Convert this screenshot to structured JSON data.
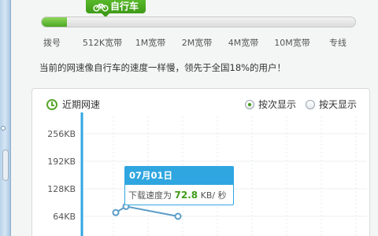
{
  "speed_badge": {
    "label": "自行车",
    "icon": "bicycle-icon"
  },
  "speed_bar": {
    "fill_fraction": 0.08
  },
  "speed_ticks": [
    "拨号",
    "512K宽带",
    "1M宽带",
    "2M宽带",
    "4M宽带",
    "10M宽带",
    "专线"
  ],
  "summary_text": "当前的网速像自行车的速度一样慢，领先于全国18%的用户！",
  "chart_panel": {
    "title": "近期网速",
    "title_icon": "clock-icon",
    "view_options": [
      {
        "label": "按次显示",
        "selected": true
      },
      {
        "label": "按天显示",
        "selected": false
      }
    ]
  },
  "tooltip": {
    "date": "07月01日",
    "prefix": "下载速度为",
    "value": "72.8",
    "unit": "KB/ 秒"
  },
  "chart_data": {
    "type": "line",
    "y_ticks": [
      "256KB",
      "192KB",
      "128KB",
      "64KB"
    ],
    "y_tick_values": [
      256,
      192,
      128,
      64
    ],
    "ylim": [
      0,
      300
    ],
    "series": [
      {
        "values": [
          72.8,
          87,
          64
        ]
      }
    ],
    "line_color": "#2fa6e0",
    "grid": true
  }
}
